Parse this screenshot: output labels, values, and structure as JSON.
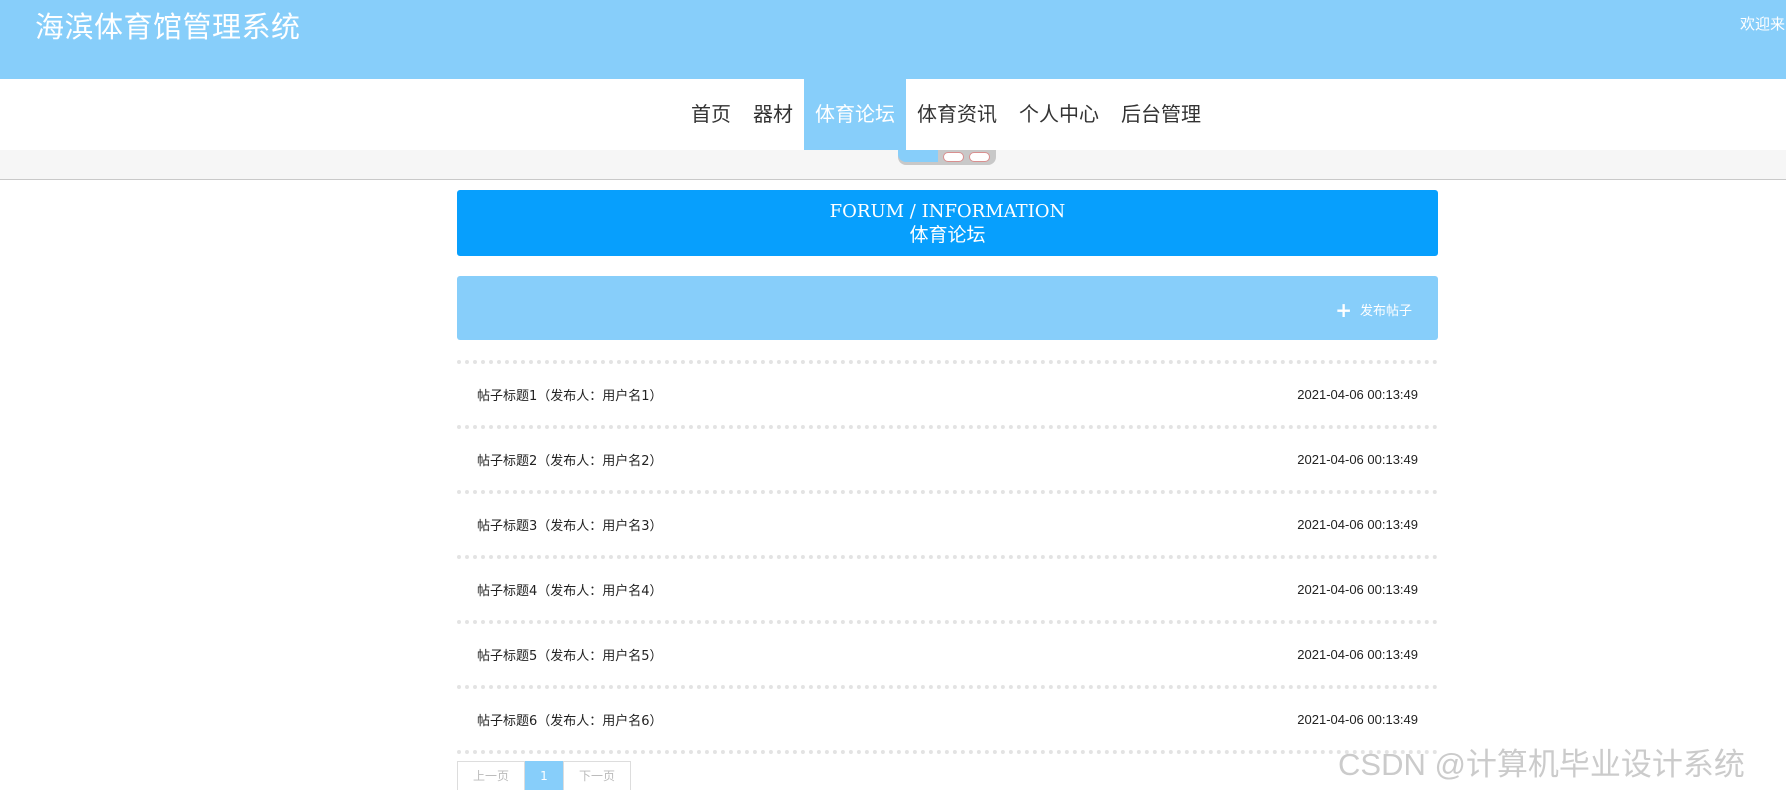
{
  "header": {
    "site_title": "海滨体育馆管理系统",
    "welcome_text": "欢迎来"
  },
  "nav": {
    "items": [
      {
        "label": "首页",
        "active": false
      },
      {
        "label": "器材",
        "active": false
      },
      {
        "label": "体育论坛",
        "active": true
      },
      {
        "label": "体育资讯",
        "active": false
      },
      {
        "label": "个人中心",
        "active": false
      },
      {
        "label": "后台管理",
        "active": false
      }
    ]
  },
  "section": {
    "title_en": "FORUM / INFORMATION",
    "title_cn": "体育论坛"
  },
  "actions": {
    "publish_label": "发布帖子",
    "publish_icon": "plus-icon"
  },
  "posts": [
    {
      "title": "帖子标题1（发布人：用户名1）",
      "time": "2021-04-06 00:13:49"
    },
    {
      "title": "帖子标题2（发布人：用户名2）",
      "time": "2021-04-06 00:13:49"
    },
    {
      "title": "帖子标题3（发布人：用户名3）",
      "time": "2021-04-06 00:13:49"
    },
    {
      "title": "帖子标题4（发布人：用户名4）",
      "time": "2021-04-06 00:13:49"
    },
    {
      "title": "帖子标题5（发布人：用户名5）",
      "time": "2021-04-06 00:13:49"
    },
    {
      "title": "帖子标题6（发布人：用户名6）",
      "time": "2021-04-06 00:13:49"
    }
  ],
  "pagination": {
    "prev_label": "上一页",
    "current_page": "1",
    "next_label": "下一页"
  },
  "watermark": "CSDN @计算机毕业设计系统",
  "colors": {
    "header_bg": "#87cefa",
    "section_bg": "#079ffd",
    "active_nav_bg": "#87cefa"
  }
}
